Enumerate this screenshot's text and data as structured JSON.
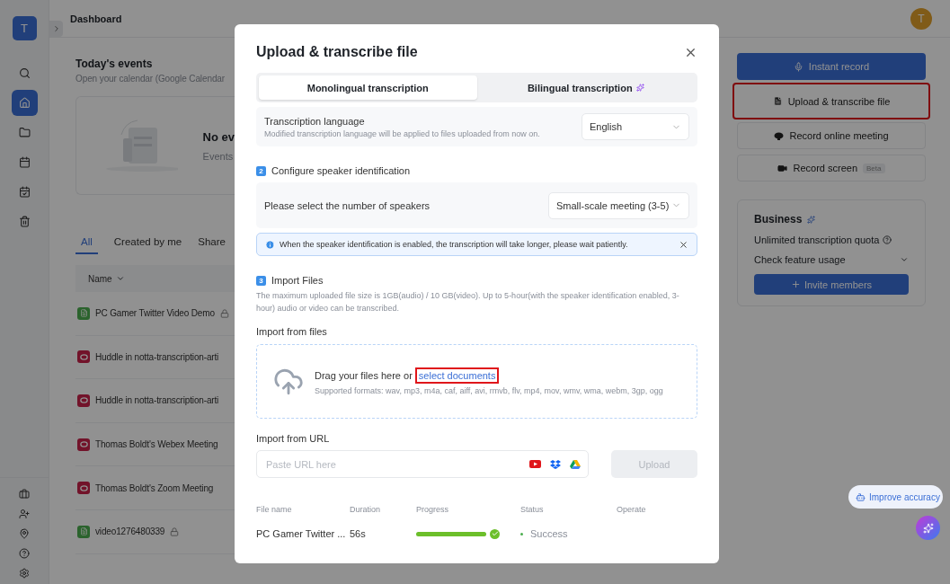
{
  "header": {
    "title": "Dashboard",
    "avatar": "T"
  },
  "sidebar": {
    "avatar": "T",
    "items": [
      {
        "selected": false
      },
      {
        "selected": true
      },
      {
        "selected": false
      },
      {
        "selected": false
      },
      {
        "selected": false
      },
      {
        "selected": false
      }
    ]
  },
  "events": {
    "title": "Today's events",
    "subtitle": "Open your calendar (Google Calendar",
    "empty_title": "No ev",
    "empty_text": "Events"
  },
  "tabs": [
    {
      "label": "All",
      "selected": true
    },
    {
      "label": "Created by me",
      "selected": false
    },
    {
      "label": "Share",
      "selected": false
    }
  ],
  "table": {
    "columns": [
      "Name"
    ],
    "rows": [
      {
        "name": "PC Gamer Twitter Video Demo",
        "kind": "file",
        "locked": true
      },
      {
        "name": "Huddle in notta-transcription-arti",
        "kind": "meeting",
        "locked": false
      },
      {
        "name": "Huddle in notta-transcription-arti",
        "kind": "meeting",
        "locked": false
      },
      {
        "name": "Thomas Boldt's Webex Meeting",
        "kind": "meeting",
        "locked": false
      },
      {
        "name": "Thomas Boldt's Zoom Meeting",
        "kind": "meeting",
        "locked": false
      },
      {
        "name": "video1276480339",
        "kind": "file",
        "locked": true
      }
    ]
  },
  "actions": [
    {
      "label": "Instant record",
      "kind": "primary",
      "highlighted": false
    },
    {
      "label": "Upload & transcribe file",
      "kind": "upload",
      "highlighted": true
    },
    {
      "label": "Record online meeting",
      "kind": "meeting",
      "highlighted": false
    },
    {
      "label": "Record screen",
      "kind": "screen",
      "highlighted": false,
      "badge": "Beta"
    }
  ],
  "plan": {
    "title": "Business",
    "quota": "Unlimited transcription quota",
    "usage": "Check feature usage",
    "invite": "Invite members"
  },
  "assist": {
    "label": "Improve accuracy"
  },
  "dialog": {
    "title": "Upload & transcribe file",
    "modes": [
      {
        "label": "Monolingual transcription",
        "selected": true
      },
      {
        "label": "Bilingual transcription",
        "selected": false
      }
    ],
    "language": {
      "label": "Transcription language",
      "hint": "Modified transcription language will be applied to files uploaded from now on.",
      "value": "English"
    },
    "speaker_section": {
      "number": "2",
      "title": "Configure speaker identification",
      "label": "Please select the number of speakers",
      "value": "Small-scale meeting (3-5)",
      "notice": "When the speaker identification is enabled, the transcription will take longer, please wait patiently."
    },
    "import_section": {
      "number": "3",
      "title": "Import Files",
      "description": "The maximum uploaded file size is 1GB(audio) / 10 GB(video). Up to 5-hour(with the speaker identification enabled, 3-hour) audio or video can be transcribed.",
      "files_label": "Import from files",
      "drop_text": "Drag your files here or",
      "drop_link": "select documents",
      "link_highlighted": true,
      "formats": "Supported formats: wav, mp3, m4a, caf, aiff, avi, rmvb, flv, mp4, mov, wmv, wma, webm, 3gp, ogg",
      "url_label": "Import from URL",
      "url_placeholder": "Paste URL here",
      "upload": "Upload",
      "upload_disabled": true
    },
    "uploads": {
      "columns": [
        "File name",
        "Duration",
        "Progress",
        "Status",
        "Operate"
      ],
      "rows": [
        {
          "file_name": "PC Gamer Twitter ...",
          "duration": "56s",
          "level": 1,
          "status": "Success",
          "done": true
        }
      ]
    }
  }
}
